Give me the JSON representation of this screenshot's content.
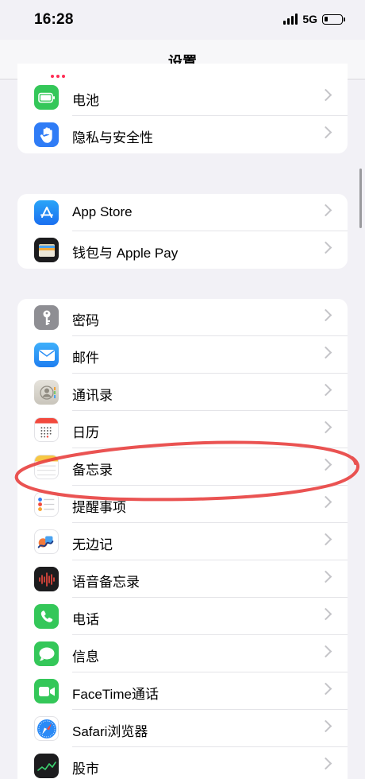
{
  "status": {
    "time": "16:28",
    "network": "5G"
  },
  "nav": {
    "title": "设置"
  },
  "groups": [
    {
      "items": [
        {
          "label": "电池",
          "icon": "battery-icon",
          "color": "#34c759"
        },
        {
          "label": "隐私与安全性",
          "icon": "hand-icon",
          "color": "#2f7cf6"
        }
      ]
    },
    {
      "items": [
        {
          "label": "App Store",
          "icon": "app-store-icon",
          "color": "#1e8ef6"
        },
        {
          "label": "钱包与 Apple Pay",
          "icon": "wallet-icon",
          "color": "#1c1c1e"
        }
      ]
    },
    {
      "items": [
        {
          "label": "密码",
          "icon": "key-icon",
          "color": "#8e8e93"
        },
        {
          "label": "邮件",
          "icon": "mail-icon",
          "color": "#2b8ff6"
        },
        {
          "label": "通讯录",
          "icon": "contacts-icon",
          "color": "#c8c4bb"
        },
        {
          "label": "日历",
          "icon": "calendar-icon",
          "color": "#ffffff"
        },
        {
          "label": "备忘录",
          "icon": "notes-icon",
          "color": "#ffffff"
        },
        {
          "label": "提醒事项",
          "icon": "reminders-icon",
          "color": "#ffffff"
        },
        {
          "label": "无边记",
          "icon": "freeform-icon",
          "color": "#ffffff"
        },
        {
          "label": "语音备忘录",
          "icon": "voice-memos-icon",
          "color": "#1c1c1e"
        },
        {
          "label": "电话",
          "icon": "phone-icon",
          "color": "#34c759"
        },
        {
          "label": "信息",
          "icon": "messages-icon",
          "color": "#34c759"
        },
        {
          "label": "FaceTime通话",
          "icon": "facetime-icon",
          "color": "#34c759"
        },
        {
          "label": "Safari浏览器",
          "icon": "safari-icon",
          "color": "#ffffff"
        },
        {
          "label": "股市",
          "icon": "stocks-icon",
          "color": "#1c1c1e"
        }
      ]
    }
  ]
}
